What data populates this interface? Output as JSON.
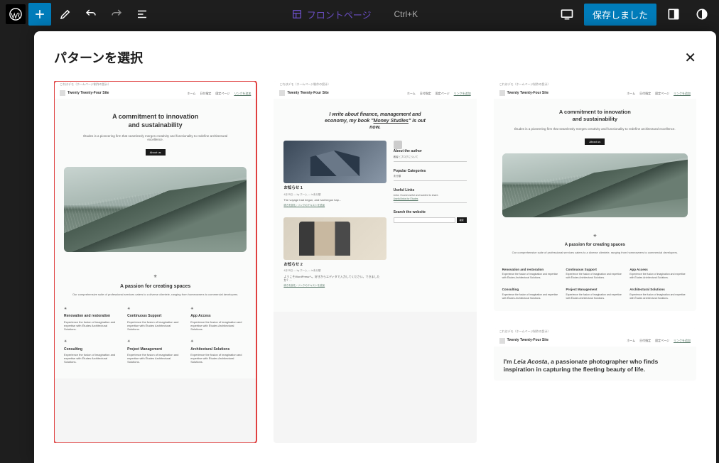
{
  "topbar": {
    "page_label": "フロントページ",
    "shortcut": "Ctrl+K",
    "save_label": "保存しました"
  },
  "modal": {
    "title": "パターンを選択"
  },
  "patterns": {
    "common": {
      "topbar_text": "これはデモ（ホームページ制作の設计）",
      "site_name": "Twenty Twenty-Four Site",
      "nav": [
        "ホーム",
        "日付指定",
        "固定ページ",
        "リンクを追加"
      ]
    },
    "p1": {
      "hero_title_1": "A commitment to innovation",
      "hero_title_2": "and sustainability",
      "hero_desc": "Études is a pioneering firm that seamlessly merges creativity and functionality to redefine architectural excellence.",
      "hero_btn": "About us",
      "section_title": "A passion for creating spaces",
      "section_desc": "Our comprehensive suite of professional services caters to a diverse clientele, ranging from homeowners to commercial developers.",
      "cols_row1": [
        {
          "title": "Renovation and restoration",
          "desc": "Experience the fusion of imagination and expertise with Études Architectural Solutions."
        },
        {
          "title": "Continuous Support",
          "desc": "Experience the fusion of imagination and expertise with Études Architectural Solutions."
        },
        {
          "title": "App Access",
          "desc": "Experience the fusion of imagination and expertise with Études Architectural Solutions."
        }
      ],
      "cols_row2": [
        {
          "title": "Consulting",
          "desc": "Experience the fusion of imagination and expertise with Études Architectural Solutions."
        },
        {
          "title": "Project Management",
          "desc": "Experience the fusion of imagination and expertise with Études Architectural Solutions."
        },
        {
          "title": "Architectural Solutions",
          "desc": "Experience the fusion of imagination and expertise with Études Architectural Solutions."
        }
      ]
    },
    "p2": {
      "hero_line1": "I write about finance, management and",
      "hero_line2_a": "economy, my book \"",
      "hero_line2_b": "Money Studies",
      "hero_line2_c": "\" is out",
      "hero_line3": "now.",
      "post1_title": "お知らせ 1",
      "post1_meta": "4月25日 — by ホーム — in未分類",
      "post1_excerpt": "The voyage had begun, and had begun hap...",
      "post1_link": "続きを読む: リンクのテキストを追加",
      "post2_title": "お知らせ 2",
      "post2_meta": "4月25日 — by ホーム — in未分類",
      "post2_excerpt": "ようこそWordPressへ。好きからエディタで入力してください。できましたか？...",
      "post2_link": "続きを読む: リンクのテキストを追加",
      "sidebar": {
        "about_title": "About the author",
        "about_desc": "著者とブログについて",
        "categories_title": "Popular Categories",
        "categories_desc": "未分類",
        "links_title": "Useful Links",
        "links_desc": "Links I found useful and wanted to share.",
        "links_item": "Useful links for Études",
        "search_title": "Search the website",
        "search_btn": "検索"
      }
    },
    "p3": {
      "cols_row2": [
        {
          "title": "Consulting",
          "desc": "Experience the fusion of imagination and expertise with Études Architectural Solutions."
        },
        {
          "title": "Project Management",
          "desc": "Experience the fusion of imagination and expertise with Études Architectural Solutions."
        },
        {
          "title": "Architectural Solutions",
          "desc": "Experience the fusion of imagination and expertise with Études Architectural Solutions."
        }
      ]
    },
    "p4": {
      "hero_a": "I'm ",
      "hero_name": "Leia Acosta",
      "hero_b": ", a passionate photographer who finds inspiration in capturing the fleeting beauty of life."
    }
  }
}
